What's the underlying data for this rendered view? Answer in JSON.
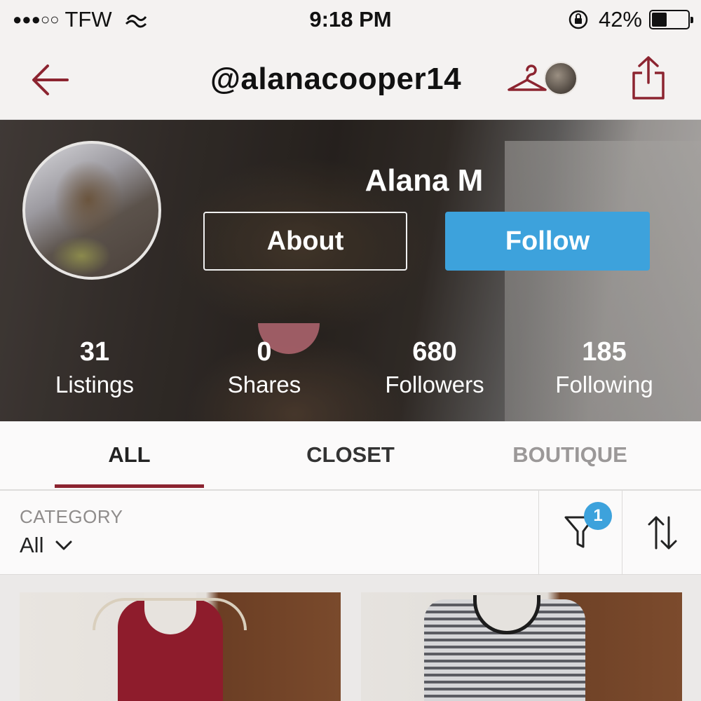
{
  "status_bar": {
    "signal_dots": "●●●○○",
    "carrier": "TFW",
    "time": "9:18 PM",
    "battery_percent": "42%",
    "battery_level": 0.42
  },
  "nav": {
    "title": "@alanacooper14"
  },
  "profile": {
    "name": "Alana M",
    "about_label": "About",
    "follow_label": "Follow",
    "stats": [
      {
        "value": "31",
        "label": "Listings"
      },
      {
        "value": "0",
        "label": "Shares"
      },
      {
        "value": "680",
        "label": "Followers"
      },
      {
        "value": "185",
        "label": "Following"
      }
    ]
  },
  "tabs": [
    {
      "label": "ALL",
      "active": true
    },
    {
      "label": "CLOSET",
      "active": false
    },
    {
      "label": "BOUTIQUE",
      "active": false
    }
  ],
  "filter": {
    "category_label": "CATEGORY",
    "category_value": "All",
    "filter_count": "1"
  },
  "colors": {
    "accent": "#8c2430",
    "follow_blue": "#3da2dc"
  },
  "icons": {
    "back": "arrow-left-icon",
    "closet": "hanger-icon",
    "share": "share-icon",
    "filter": "funnel-icon",
    "sort": "sort-arrows-icon",
    "category_chevron": "chevron-down-icon"
  }
}
